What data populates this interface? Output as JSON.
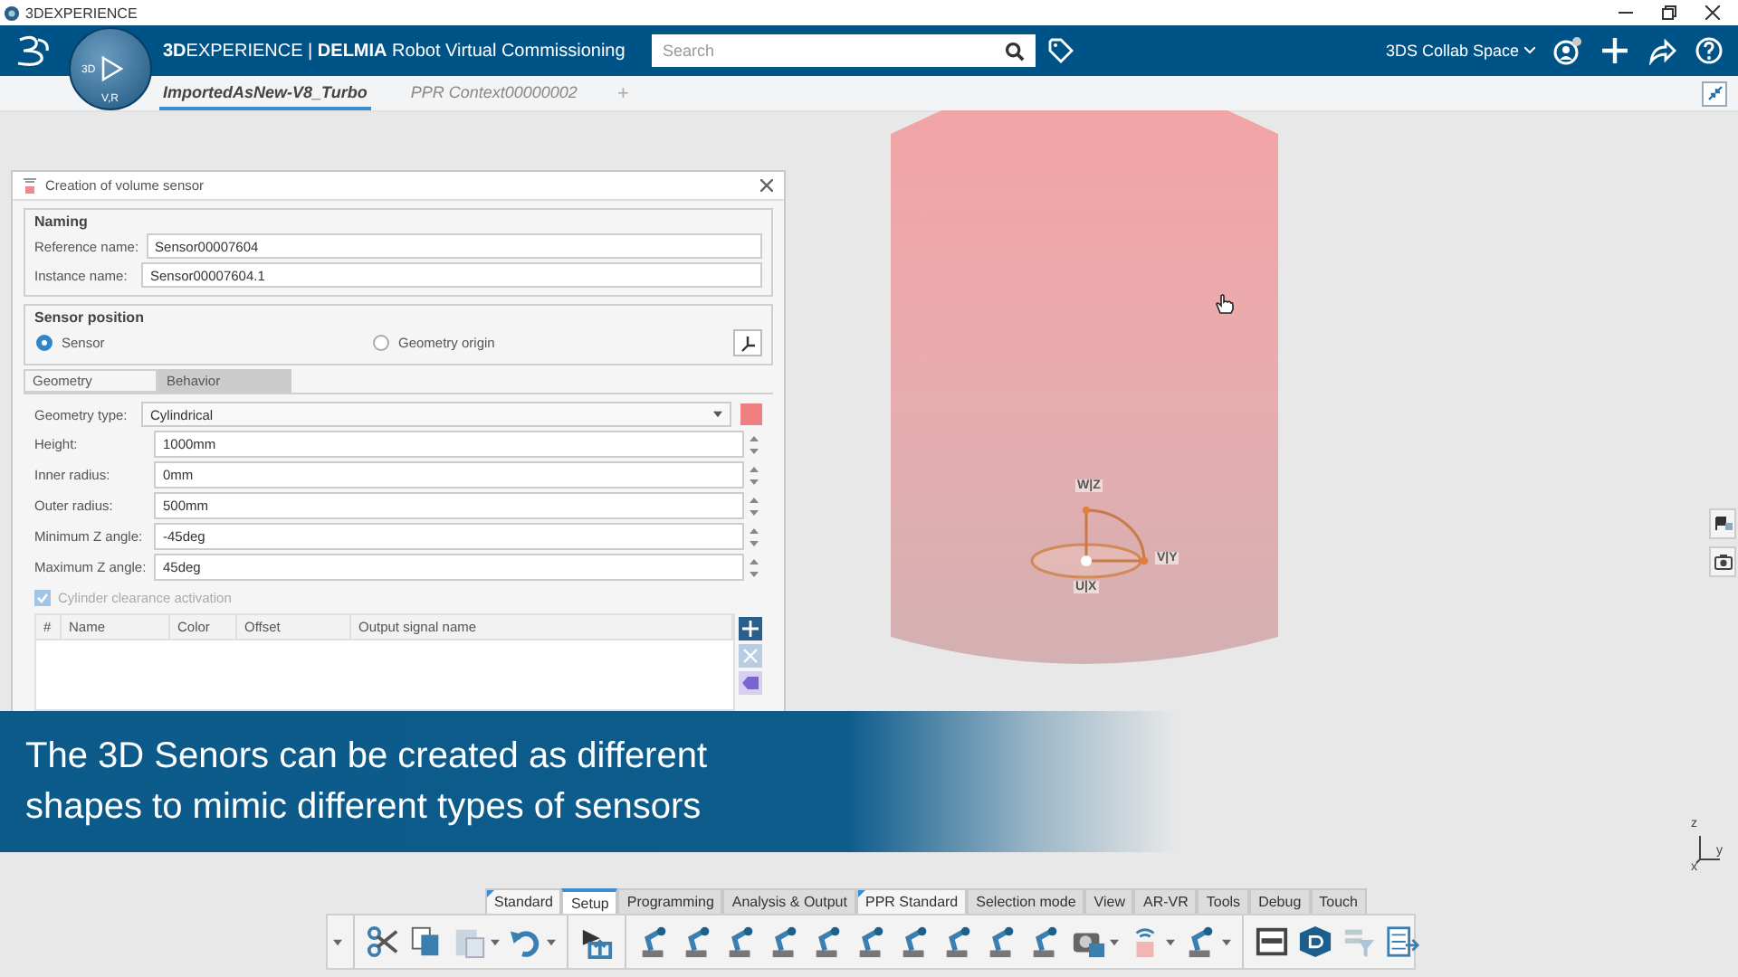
{
  "window": {
    "title": "3DEXPERIENCE"
  },
  "topbar": {
    "brand": "**3D**EXPERIENCE | **DELMIA** Robot Virtual Commissioning",
    "compass_labels": [
      "3D",
      "V,R"
    ],
    "search": {
      "placeholder": "Search"
    },
    "collab_space": "3DS Collab Space"
  },
  "tabs": [
    {
      "label": "ImportedAsNew-V8_Turbo",
      "selected": true
    },
    {
      "label": "PPR Context00000002",
      "selected": false
    }
  ],
  "add_tab": "+",
  "dialog": {
    "title": "Creation of volume sensor",
    "naming": {
      "legend": "Naming",
      "fields": [
        {
          "label": "Reference name:",
          "value": "Sensor00007604"
        },
        {
          "label": "Instance name:",
          "value": "Sensor00007604.1"
        }
      ]
    },
    "sensor_position": {
      "legend": "Sensor position",
      "options": [
        {
          "label": "Sensor",
          "selected": true
        },
        {
          "label": "Geometry origin",
          "selected": false
        }
      ]
    },
    "tabs": [
      {
        "label": "Geometry",
        "selected": true
      },
      {
        "label": "Behavior",
        "selected": false
      }
    ],
    "geometry_type": {
      "label": "Geometry type:",
      "value": "Cylindrical",
      "color": "#f08080"
    },
    "parameters": [
      {
        "label": "Height:",
        "value": "1000mm"
      },
      {
        "label": "Inner radius:",
        "value": "0mm"
      },
      {
        "label": "Outer radius:",
        "value": "500mm"
      },
      {
        "label": "Minimum Z angle:",
        "value": "-45deg"
      },
      {
        "label": "Maximum Z angle:",
        "value": "45deg"
      }
    ],
    "clearance": {
      "label": "Cylinder clearance activation",
      "checked": true,
      "disabled": true
    },
    "table": {
      "columns": [
        "#",
        "Name",
        "Color",
        "Offset",
        "Output signal name"
      ]
    }
  },
  "viewport": {
    "gizmo_labels": [
      "W|Z",
      "V|Y",
      "U|X"
    ],
    "triad_labels": [
      "z",
      "y",
      "x"
    ]
  },
  "caption": "The 3D Senors can be created as different shapes to mimic different types of sensors",
  "action_bar": {
    "tabs": [
      {
        "label": "Standard",
        "selected": false,
        "pinned": true
      },
      {
        "label": "Setup",
        "selected": true,
        "pinned": false
      },
      {
        "label": "Programming",
        "selected": false,
        "pinned": false
      },
      {
        "label": "Analysis & Output",
        "selected": false,
        "pinned": false
      },
      {
        "label": "PPR Standard",
        "selected": false,
        "pinned": true
      },
      {
        "label": "Selection mode",
        "selected": false,
        "pinned": false
      },
      {
        "label": "View",
        "selected": false,
        "pinned": false
      },
      {
        "label": "AR-VR",
        "selected": false,
        "pinned": false
      },
      {
        "label": "Tools",
        "selected": false,
        "pinned": false
      },
      {
        "label": "Debug",
        "selected": false,
        "pinned": false
      },
      {
        "label": "Touch",
        "selected": false,
        "pinned": false
      }
    ]
  }
}
